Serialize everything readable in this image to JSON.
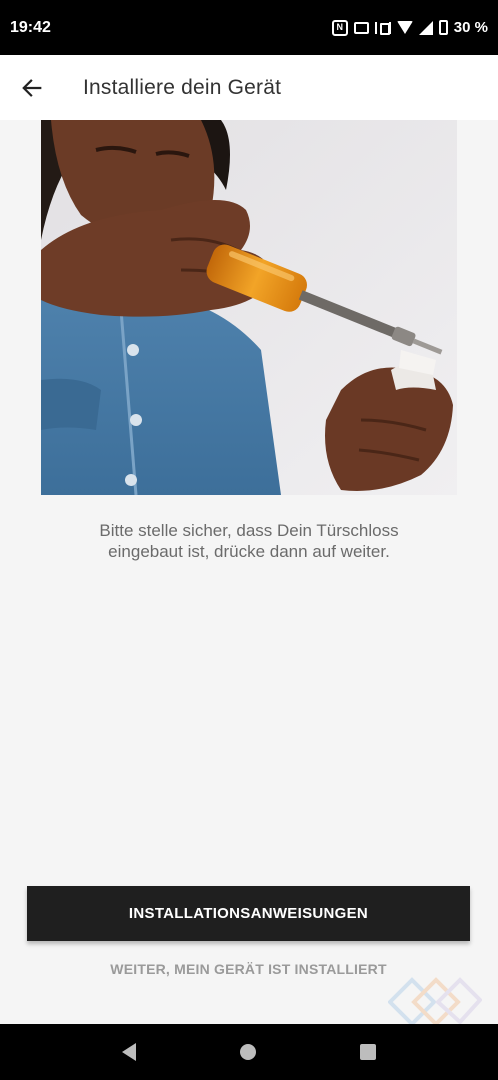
{
  "status_bar": {
    "time": "19:42",
    "battery_text": "30 %",
    "icons": [
      "nfc-icon",
      "briefcase-icon",
      "vibrate-icon",
      "wifi-icon",
      "signal-icon",
      "battery-icon"
    ]
  },
  "app_bar": {
    "back_icon": "arrow-left-icon",
    "title": "Installiere dein Gerät"
  },
  "hero": {
    "subject": "person-with-screwdriver-photo"
  },
  "instruction": {
    "line1": "Bitte stelle sicher, dass Dein Türschloss",
    "line2": "eingebaut ist, drücke dann auf weiter."
  },
  "actions": {
    "primary_label": "INSTALLATIONSANWEISUNGEN",
    "secondary_label": "WEITER, MEIN GERÄT IST INSTALLIERT"
  },
  "nav_bar": {
    "icons": [
      "nav-back-icon",
      "nav-home-icon",
      "nav-recents-icon"
    ]
  },
  "colors": {
    "status_bar_bg": "#000000",
    "page_bg": "#f5f5f5",
    "primary_button_bg": "#1f1f1f",
    "secondary_text": "#9a9a9a",
    "body_text": "#6b6b6b",
    "screwdriver_handle": "#e8920c"
  }
}
